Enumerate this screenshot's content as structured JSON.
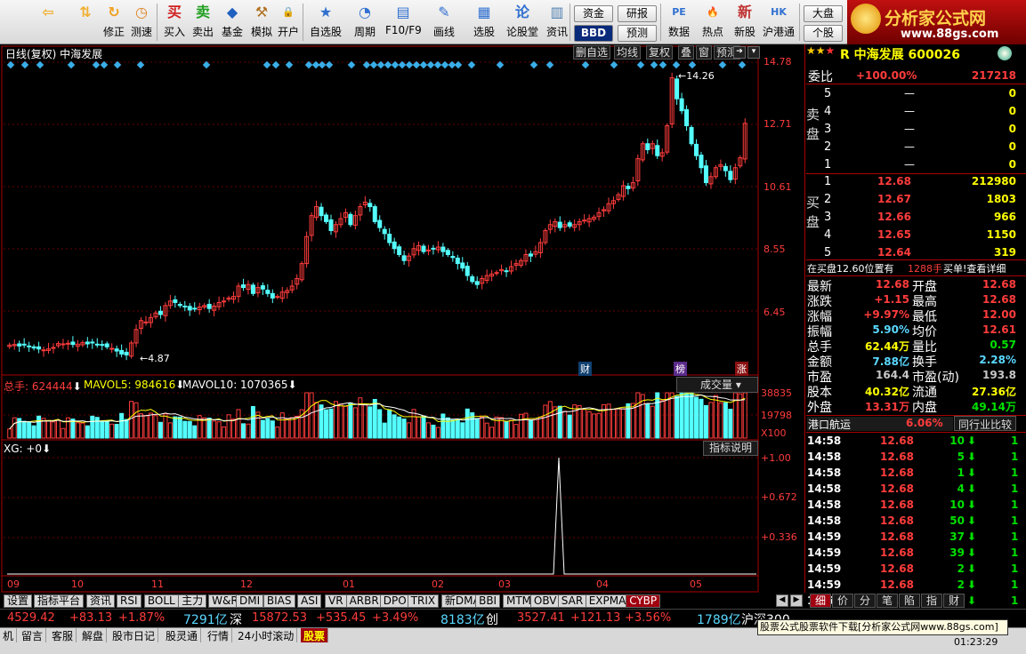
{
  "toolbar": {
    "items": [
      {
        "label": "",
        "icon": "back-arrow-icon"
      },
      {
        "label": "",
        "icon": "up-down-icon"
      },
      {
        "label": "修正",
        "icon": "refresh-icon"
      },
      {
        "label": "测速",
        "icon": "clock-icon"
      },
      {
        "label": "买入",
        "icon": "buy-icon"
      },
      {
        "label": "卖出",
        "icon": "sell-icon"
      },
      {
        "label": "基金",
        "icon": "fund-icon"
      },
      {
        "label": "模拟",
        "icon": "hammer-icon"
      },
      {
        "label": "开户",
        "icon": "lock-icon"
      },
      {
        "label": "自选股",
        "icon": "star-icon"
      },
      {
        "label": "周期",
        "icon": "cycle-icon"
      },
      {
        "label": "F10/F9",
        "icon": "f10-icon"
      },
      {
        "label": "画线",
        "icon": "pen-icon"
      },
      {
        "label": "选股",
        "icon": "select-icon"
      },
      {
        "label": "论股堂",
        "icon": "forum-icon"
      },
      {
        "label": "资讯",
        "icon": "news-icon"
      },
      {
        "label": "数据",
        "icon": "data-icon"
      },
      {
        "label": "热点",
        "icon": "hot-icon"
      },
      {
        "label": "新股",
        "icon": "ipo-icon"
      },
      {
        "label": "沪港通",
        "icon": "hk-icon"
      }
    ],
    "small": {
      "zijin": "资金",
      "yanbao": "研报",
      "bbd": "BBD",
      "yuce": "预测",
      "dapan": "大盘",
      "gegu": "个股"
    },
    "logo_title": "分析家公式网",
    "logo_url": "www.88gs.com"
  },
  "chart_header": {
    "left": "日线(复权)  中海发展",
    "buttons": [
      "删自选",
      "均线",
      "复权",
      "叠",
      "窗",
      "预测"
    ]
  },
  "price_axis": [
    "14.78",
    "12.71",
    "10.61",
    "8.55",
    "6.45"
  ],
  "annot": {
    "high": "14.26",
    "low": "4.87",
    "cai": "财",
    "bang": "榜",
    "zhang": "涨"
  },
  "volume": {
    "label_total": "总手: 624444",
    "mavol5": "MAVOL5: 984616",
    "mavol10": "MAVOL10: 1070365",
    "select": "成交量",
    "axis": [
      "38835",
      "19798",
      "X100"
    ]
  },
  "indicator": {
    "label": "XG: +0",
    "btn": "指标说明",
    "axis": [
      "+1.00",
      "+0.672",
      "+0.336"
    ]
  },
  "months": [
    "09",
    "10",
    "11",
    "12",
    "01",
    "02",
    "03",
    "04",
    "05"
  ],
  "tabs": [
    "设置",
    "指标平台",
    "资讯",
    "RSI",
    "BOLL",
    "主力",
    "W&R",
    "DMI",
    "BIAS",
    "ASI",
    "VR",
    "ARBR",
    "DPO",
    "TRIX",
    "新DMA",
    "BBI",
    "MTM",
    "OBV",
    "SAR",
    "EXPMA",
    "CYBP"
  ],
  "right": {
    "title": "R 中海发展 600026",
    "weibi_label": "委比",
    "weibi": "+100.00%",
    "weicha": "217218",
    "sell_side": "卖盘",
    "buy_side": "买盘",
    "asks": [
      {
        "n": "5",
        "p": "—",
        "v": "0"
      },
      {
        "n": "4",
        "p": "—",
        "v": "0"
      },
      {
        "n": "3",
        "p": "—",
        "v": "0"
      },
      {
        "n": "2",
        "p": "—",
        "v": "0"
      },
      {
        "n": "1",
        "p": "—",
        "v": "0"
      }
    ],
    "bids": [
      {
        "n": "1",
        "p": "12.68",
        "v": "212980"
      },
      {
        "n": "2",
        "p": "12.67",
        "v": "1803"
      },
      {
        "n": "3",
        "p": "12.66",
        "v": "966"
      },
      {
        "n": "4",
        "p": "12.65",
        "v": "1150"
      },
      {
        "n": "5",
        "p": "12.64",
        "v": "319"
      }
    ],
    "note": "在买盘12.60位置有",
    "note_v": "1288手",
    "note_btn": "买单!查看详细",
    "stats": [
      {
        "l1": "最新",
        "v1": "12.68",
        "c1": "red",
        "l2": "开盘",
        "v2": "12.68",
        "c2": "red"
      },
      {
        "l1": "涨跌",
        "v1": "+1.15",
        "c1": "red",
        "l2": "最高",
        "v2": "12.68",
        "c2": "red"
      },
      {
        "l1": "涨幅",
        "v1": "+9.97%",
        "c1": "red",
        "l2": "最低",
        "v2": "12.00",
        "c2": "red"
      },
      {
        "l1": "振幅",
        "v1": "5.90%",
        "c1": "cyan",
        "l2": "均价",
        "v2": "12.61",
        "c2": "red"
      },
      {
        "l1": "总手",
        "v1": "62.44万",
        "c1": "yellow",
        "l2": "量比",
        "v2": "0.57",
        "c2": "green"
      },
      {
        "l1": "金额",
        "v1": "7.88亿",
        "c1": "cyan",
        "l2": "换手",
        "v2": "2.28%",
        "c2": "cyan"
      },
      {
        "l1": "市盈",
        "v1": "164.4",
        "c1": "gray",
        "l2": "市盈(动)",
        "v2": "193.8",
        "c2": "gray"
      },
      {
        "l1": "股本",
        "v1": "40.32亿",
        "c1": "yellow",
        "l2": "流通",
        "v2": "27.36亿",
        "c2": "yellow"
      },
      {
        "l1": "外盘",
        "v1": "13.31万",
        "c1": "red",
        "l2": "内盘",
        "v2": "49.14万",
        "c2": "green"
      }
    ],
    "sector": "港口航运",
    "sector_pct": "6.06%",
    "sector_btn": "同行业比较",
    "ticks": [
      {
        "t": "14:58",
        "p": "12.68",
        "v": "10"
      },
      {
        "t": "14:58",
        "p": "12.68",
        "v": "5"
      },
      {
        "t": "14:58",
        "p": "12.68",
        "v": "1"
      },
      {
        "t": "14:58",
        "p": "12.68",
        "v": "4"
      },
      {
        "t": "14:58",
        "p": "12.68",
        "v": "10"
      },
      {
        "t": "14:58",
        "p": "12.68",
        "v": "50"
      },
      {
        "t": "14:59",
        "p": "12.68",
        "v": "37"
      },
      {
        "t": "14:59",
        "p": "12.68",
        "v": "39"
      },
      {
        "t": "14:59",
        "p": "12.68",
        "v": "2"
      },
      {
        "t": "14:59",
        "p": "12.68",
        "v": "2"
      },
      {
        "t": "14:59",
        "p": "12.68",
        "v": "1"
      }
    ],
    "tick_right": "1",
    "rtabs": [
      "细",
      "价",
      "分",
      "笔",
      "陷",
      "指",
      "财"
    ]
  },
  "index_bar": {
    "sh": "4529.42",
    "sh_chg": "+83.13",
    "sh_pct": "+1.87%",
    "sh_amt": "7291亿",
    "sz_label": "深",
    "sz": "15872.53",
    "sz_chg": "+535.45",
    "sz_pct": "+3.49%",
    "sz_amt": "8183亿",
    "cy_label": "创",
    "cy": "3527.41",
    "cy_chg": "+121.13",
    "cy_pct": "+3.56%",
    "cy_amt": "1789亿",
    "hg": "沪深300"
  },
  "status": {
    "items": [
      "机",
      "留言",
      "客服",
      "解盘",
      "股市日记",
      "股灵通",
      "行情",
      "24小时滚动",
      "股票"
    ],
    "banner": "股票公式股票软件下载[分析家公式网www.88gs.com]",
    "time": "01:23:29"
  },
  "chart_data": {
    "type": "candlestick",
    "title": "中海发展",
    "months": [
      "09",
      "10",
      "11",
      "12",
      "01",
      "02",
      "03",
      "04",
      "05"
    ],
    "ylim": [
      4.4,
      14.78
    ],
    "high_marker": 14.26,
    "low_marker": 4.87,
    "close": [
      5.28,
      5.3,
      5.25,
      5.29,
      5.22,
      5.18,
      5.15,
      5.12,
      5.15,
      5.2,
      5.33,
      5.32,
      5.34,
      5.3,
      5.31,
      5.36,
      5.32,
      5.35,
      5.3,
      5.28,
      5.22,
      5.17,
      5.08,
      4.98,
      4.95,
      5.35,
      5.8,
      6.1,
      6.05,
      6.2,
      6.35,
      6.3,
      6.6,
      6.75,
      6.7,
      6.6,
      6.55,
      6.45,
      6.5,
      6.55,
      6.6,
      6.5,
      6.58,
      6.7,
      6.75,
      6.85,
      6.9,
      7.25,
      7.2,
      7.3,
      7.0,
      7.2,
      7.15,
      7.0,
      6.85,
      6.9,
      7.05,
      7.1,
      7.25,
      7.5,
      8.0,
      8.9,
      9.6,
      9.9,
      9.6,
      9.4,
      9.1,
      9.3,
      9.5,
      9.7,
      9.3,
      9.6,
      9.9,
      10.05,
      9.9,
      9.4,
      9.2,
      9.0,
      8.7,
      8.5,
      8.3,
      8.1,
      8.25,
      8.5,
      8.6,
      8.4,
      8.45,
      8.5,
      8.55,
      8.4,
      8.3,
      8.2,
      8.0,
      7.85,
      7.6,
      7.4,
      7.3,
      7.5,
      7.6,
      7.65,
      7.7,
      7.8,
      7.75,
      7.9,
      8.0,
      8.1,
      8.3,
      8.25,
      8.4,
      8.7,
      9.1,
      9.3,
      9.4,
      9.2,
      9.3,
      9.25,
      9.3,
      9.4,
      9.45,
      9.5,
      9.55,
      9.7,
      9.8,
      10.0,
      10.1,
      10.3,
      10.6,
      10.5,
      10.7,
      11.5,
      12.0,
      11.8,
      12.0,
      11.6,
      11.7,
      12.6,
      14.2,
      13.5,
      13.1,
      12.6,
      12.0,
      11.6,
      11.2,
      10.7,
      10.9,
      11.2,
      11.3,
      11.1,
      10.8,
      11.2,
      11.53,
      12.68
    ],
    "volume_scale": {
      "max": 38835,
      "mid": 19798,
      "unit": "X100"
    },
    "indicator_XG_spike_month": "03"
  }
}
